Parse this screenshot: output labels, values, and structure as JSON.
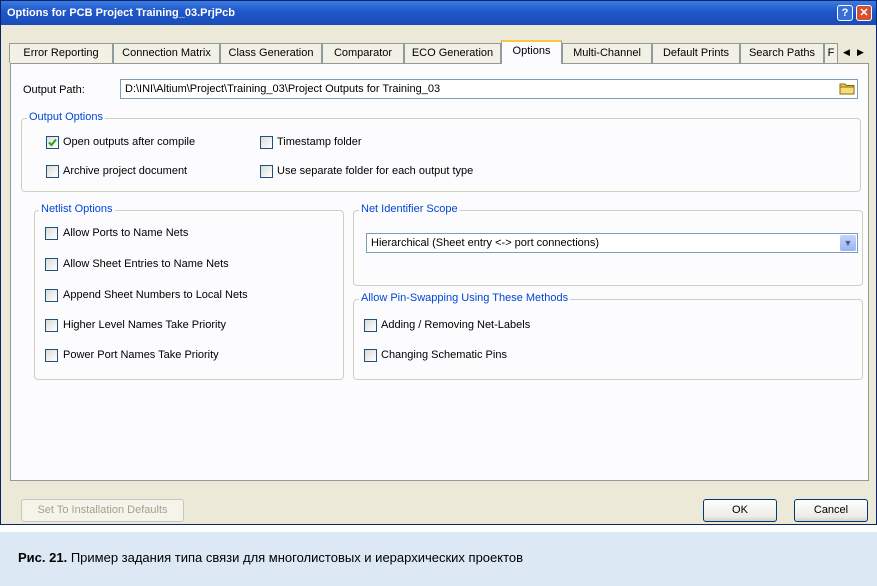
{
  "window": {
    "title": "Options for PCB Project Training_03.PrjPcb",
    "help_glyph": "?",
    "close_glyph": "✕"
  },
  "tabs": [
    {
      "label": "Error Reporting"
    },
    {
      "label": "Connection Matrix"
    },
    {
      "label": "Class Generation"
    },
    {
      "label": "Comparator"
    },
    {
      "label": "ECO Generation"
    },
    {
      "label": "Options",
      "active": true
    },
    {
      "label": "Multi-Channel"
    },
    {
      "label": "Default Prints"
    },
    {
      "label": "Search Paths"
    },
    {
      "label": "F"
    }
  ],
  "tab_scroll": {
    "left": "◀",
    "right": "▶"
  },
  "output_path": {
    "label": "Output Path:",
    "value": "D:\\INI\\Altium\\Project\\Training_03\\Project Outputs for Training_03",
    "icon": "folder-icon"
  },
  "output_options": {
    "title": "Output Options",
    "items": [
      {
        "label": "Open outputs after compile",
        "checked": true
      },
      {
        "label": "Timestamp folder",
        "checked": false
      },
      {
        "label": "Archive project document",
        "checked": false
      },
      {
        "label": "Use separate folder for each output type",
        "checked": false
      }
    ]
  },
  "netlist_options": {
    "title": "Netlist Options",
    "items": [
      {
        "label": "Allow Ports to Name Nets",
        "checked": false
      },
      {
        "label": "Allow Sheet Entries to Name Nets",
        "checked": false
      },
      {
        "label": "Append Sheet Numbers to Local Nets",
        "checked": false
      },
      {
        "label": "Higher Level Names Take Priority",
        "checked": false
      },
      {
        "label": "Power Port Names Take Priority",
        "checked": false
      }
    ]
  },
  "net_identifier_scope": {
    "title": "Net Identifier Scope",
    "selected": "Hierarchical (Sheet entry <-> port connections)"
  },
  "pin_swapping": {
    "title": "Allow Pin-Swapping Using These Methods",
    "items": [
      {
        "label": "Adding / Removing Net-Labels",
        "checked": false
      },
      {
        "label": "Changing Schematic Pins",
        "checked": false
      }
    ]
  },
  "buttons": {
    "defaults": "Set To Installation Defaults",
    "ok": "OK",
    "cancel": "Cancel"
  },
  "caption": {
    "prefix": "Рис. 21.",
    "text": " Пример задания типа связи для многолистовых и иерархических проектов"
  },
  "colors": {
    "accent": "#0046d5",
    "titlebar": "#1f56c9",
    "caption_bg": "#dce9f5"
  }
}
